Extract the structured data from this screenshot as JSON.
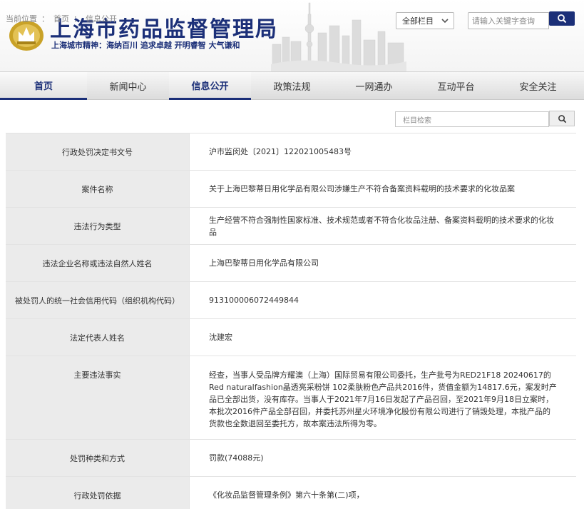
{
  "header": {
    "site_title": "上海市药品监督管理局",
    "slogan": "上海城市精神：海纳百川  追求卓越  开明睿智  大气谦和",
    "category_select": "全部栏目",
    "search_placeholder": "请输入关键字查询"
  },
  "nav": {
    "items": [
      {
        "label": "首页"
      },
      {
        "label": "新闻中心"
      },
      {
        "label": "信息公开"
      },
      {
        "label": "政策法规"
      },
      {
        "label": "一网通办"
      },
      {
        "label": "互动平台"
      },
      {
        "label": "安全关注"
      }
    ]
  },
  "breadcrumb": {
    "prefix": "当前位置",
    "sep": "：",
    "home": "首页",
    "arrow": "：",
    "current": "信息公开",
    "column_search_placeholder": "栏目检索"
  },
  "table": {
    "rows": [
      {
        "label": "行政处罚决定书文号",
        "value": "沪市监闵处〔2021〕122021005483号"
      },
      {
        "label": "案件名称",
        "value": "关于上海巴黎蒂日用化学品有限公司涉嫌生产不符合备案资料载明的技术要求的化妆品案"
      },
      {
        "label": "违法行为类型",
        "value": "生产经营不符合强制性国家标准、技术规范或者不符合化妆品注册、备案资料载明的技术要求的化妆品"
      },
      {
        "label": "违法企业名称或违法自然人姓名",
        "value": "上海巴黎蒂日用化学品有限公司"
      },
      {
        "label": "被处罚人的统一社会信用代码（组织机构代码）",
        "value": "913100006072449844"
      },
      {
        "label": "法定代表人姓名",
        "value": "沈建宏"
      },
      {
        "label": "主要违法事实",
        "value": "经查，当事人受品牌方耀澳（上海）国际贸易有限公司委托，生产批号为RED21F18 20240617的Red naturalfashion晶透亮采粉饼 102柔肤粉色产品共2016件，货值金额为14817.6元，案发时产品已全部出货，没有库存。当事人于2021年7月16日发起了产品召回，至2021年9月18日立案时，本批次2016件产品全部召回，并委托苏州星火环境净化股份有限公司进行了销毁处理，本批产品的货款也全数退回至委托方，故本案违法所得为零。"
      },
      {
        "label": "处罚种类和方式",
        "value": "罚款(74088元)"
      },
      {
        "label": "行政处罚依据",
        "value": "《化妆品监督管理条例》第六十条第(二)项，"
      }
    ]
  },
  "colors": {
    "brand": "#1b2f78",
    "label_bg": "#ebebeb",
    "logo_gold": "#c9a227"
  }
}
